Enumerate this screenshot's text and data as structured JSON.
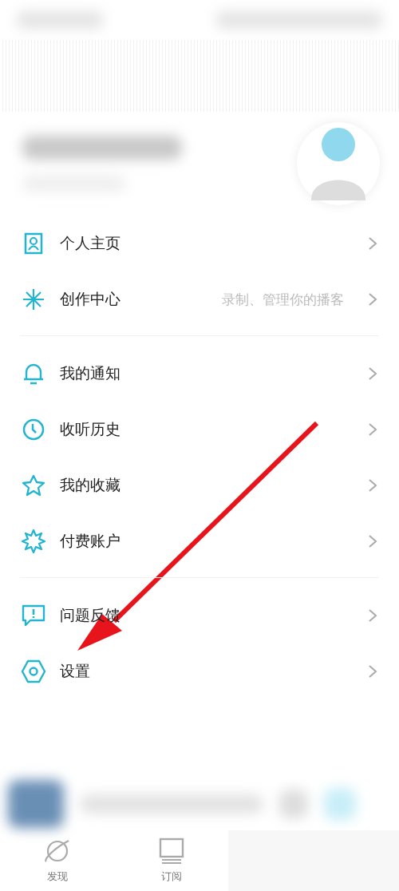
{
  "menu_sections": [
    {
      "items": [
        {
          "label": "个人主页"
        },
        {
          "label": "创作中心",
          "hint": "录制、管理你的播客"
        }
      ]
    },
    {
      "items": [
        {
          "label": "我的通知"
        },
        {
          "label": "收听历史"
        },
        {
          "label": "我的收藏"
        },
        {
          "label": "付费账户"
        }
      ]
    },
    {
      "items": [
        {
          "label": "问题反馈"
        },
        {
          "label": "设置"
        }
      ]
    }
  ],
  "tab_bar": [
    {
      "label": "发现"
    },
    {
      "label": "订阅"
    }
  ]
}
